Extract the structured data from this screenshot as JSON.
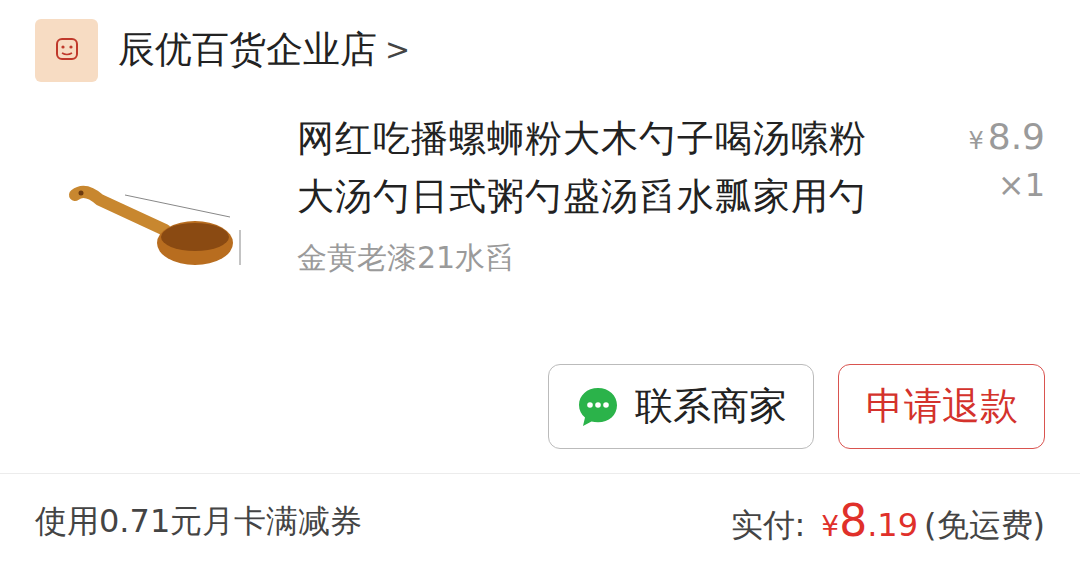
{
  "shop": {
    "name": "辰优百货企业店",
    "chevron": ">"
  },
  "product": {
    "title": "网红吃播螺蛳粉大木勺子喝汤嗦粉大汤勺日式粥勺盛汤舀水瓢家用勺",
    "variant": "金黄老漆21水舀",
    "price_currency": "¥",
    "price": "8.9",
    "quantity": "×1"
  },
  "buttons": [
    {
      "label": "联系商家",
      "kind": "contact"
    },
    {
      "label": "申请退款",
      "kind": "refund"
    }
  ],
  "footer": {
    "coupon": "使用0.71元月卡满减券",
    "paid_label": "实付:",
    "paid_currency": "¥",
    "paid_int": "8",
    "paid_dec": ".19",
    "shipping": "(免运费)"
  }
}
